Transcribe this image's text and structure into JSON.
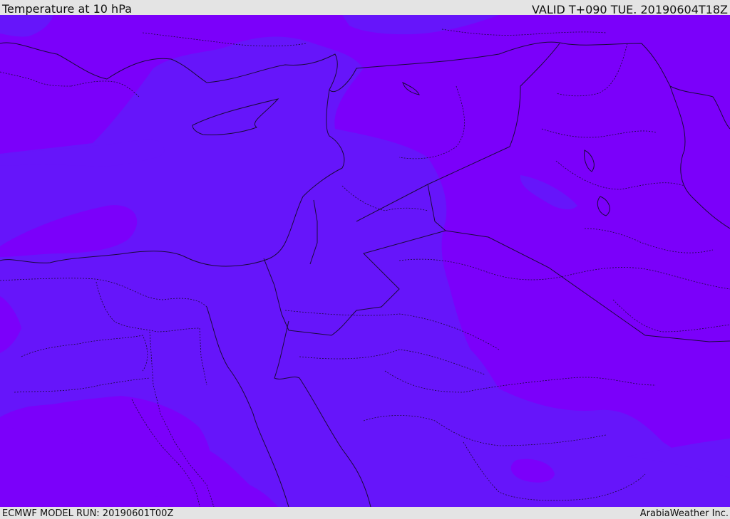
{
  "header": {
    "title": "Temperature at 10 hPa",
    "valid": "VALID T+090 TUE. 20190604T18Z"
  },
  "footer": {
    "model_run": "ECMWF MODEL RUN: 20190601T00Z",
    "credit": "ArabiaWeather Inc."
  },
  "colors": {
    "background": "#e4e4e4",
    "field_cold": "#7b00fa",
    "field_warm": "#6615fa",
    "borders": "#1a0a3a"
  },
  "map": {
    "variable": "Temperature",
    "level": "10 hPa",
    "region": "Eastern Mediterranean / Middle East"
  }
}
